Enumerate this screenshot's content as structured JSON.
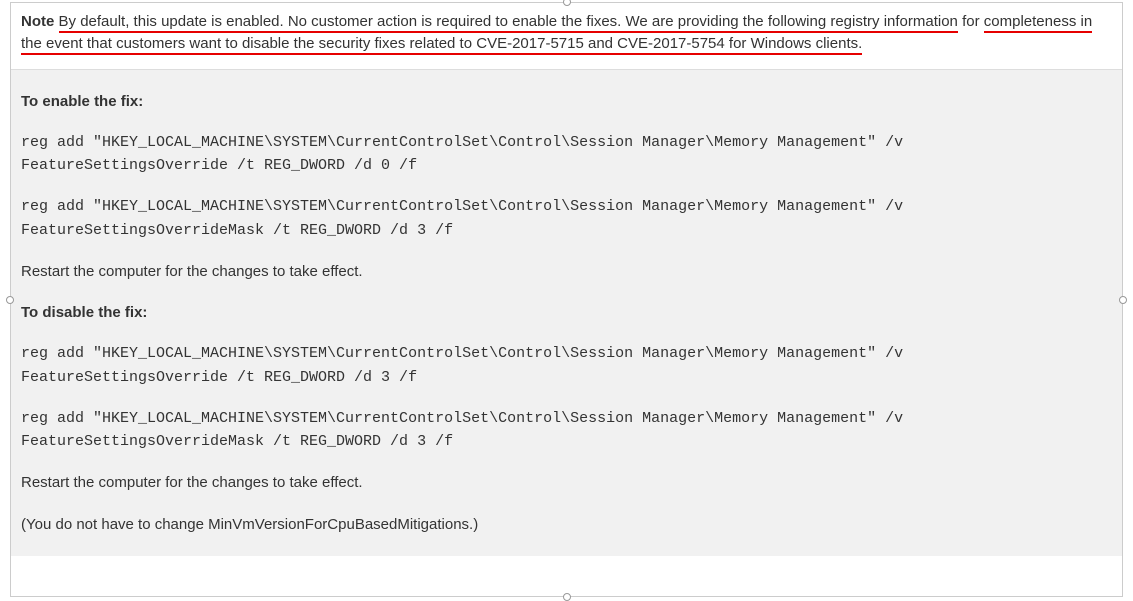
{
  "note": {
    "label": "Note",
    "underlined1": "By default, this update is enabled. No customer action is required to enable the fixes. We are providing the following registry information",
    "mid": " for ",
    "underlined2": "completeness in the event that customers want to disable the security fixes related to CVE-2017-5715 and CVE-2017-5754 for Windows clients."
  },
  "enable": {
    "heading": "To enable the fix:",
    "cmd1": "reg add \"HKEY_LOCAL_MACHINE\\SYSTEM\\CurrentControlSet\\Control\\Session Manager\\Memory Management\" /v FeatureSettingsOverride /t REG_DWORD /d 0 /f",
    "cmd2": "reg add \"HKEY_LOCAL_MACHINE\\SYSTEM\\CurrentControlSet\\Control\\Session Manager\\Memory Management\" /v FeatureSettingsOverrideMask /t REG_DWORD /d 3 /f",
    "restart": "Restart the computer for the changes to take effect."
  },
  "disable": {
    "heading": "To disable the fix:",
    "cmd1": "reg add \"HKEY_LOCAL_MACHINE\\SYSTEM\\CurrentControlSet\\Control\\Session Manager\\Memory Management\" /v FeatureSettingsOverride /t REG_DWORD /d 3 /f",
    "cmd2": "reg add \"HKEY_LOCAL_MACHINE\\SYSTEM\\CurrentControlSet\\Control\\Session Manager\\Memory Management\" /v FeatureSettingsOverrideMask /t REG_DWORD /d 3 /f",
    "restart": "Restart the computer for the changes to take effect.",
    "footnote": "(You do not have to change MinVmVersionForCpuBasedMitigations.)"
  }
}
